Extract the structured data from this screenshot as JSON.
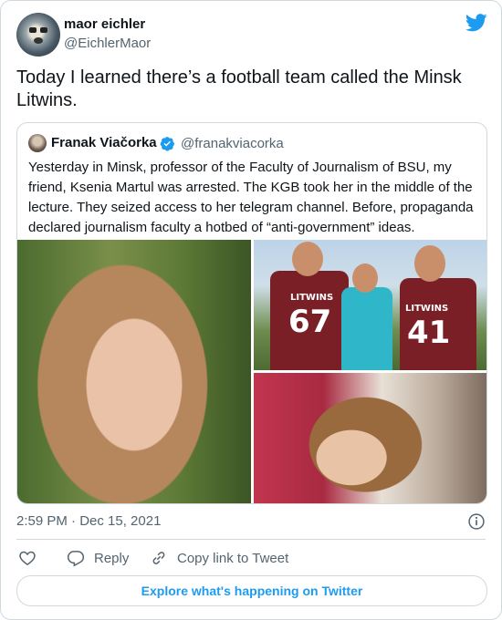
{
  "author": {
    "name": "maor eichler",
    "handle": "@EichlerMaor"
  },
  "tweet_text": "Today I learned there’s a football team called the Minsk Litwins.",
  "quoted": {
    "name": "Franak Viačorka",
    "handle": "@franakviacorka",
    "text": "Yesterday in Minsk, professor of the Faculty of Journalism of BSU, my friend, Ksenia Martul was arrested. The KGB took her in the middle of the lecture. They seized access to her telegram channel. Before, propaganda declared journalism faculty a hotbed of “anti-government” ideas.",
    "jersey_names": [
      "LITWINS",
      "LITWINS"
    ],
    "jersey_numbers": [
      "67",
      "41"
    ]
  },
  "timestamp": "2:59 PM · Dec 15, 2021",
  "actions": {
    "reply": "Reply",
    "copy_link": "Copy link to Tweet"
  },
  "explore_label": "Explore what's happening on Twitter",
  "colors": {
    "accent": "#1d9bf0",
    "secondary_text": "#536471",
    "border": "#cfd9de"
  },
  "icons": [
    "twitter-bird-icon",
    "verified-badge-icon",
    "info-icon",
    "heart-icon",
    "reply-icon",
    "copy-link-icon"
  ]
}
